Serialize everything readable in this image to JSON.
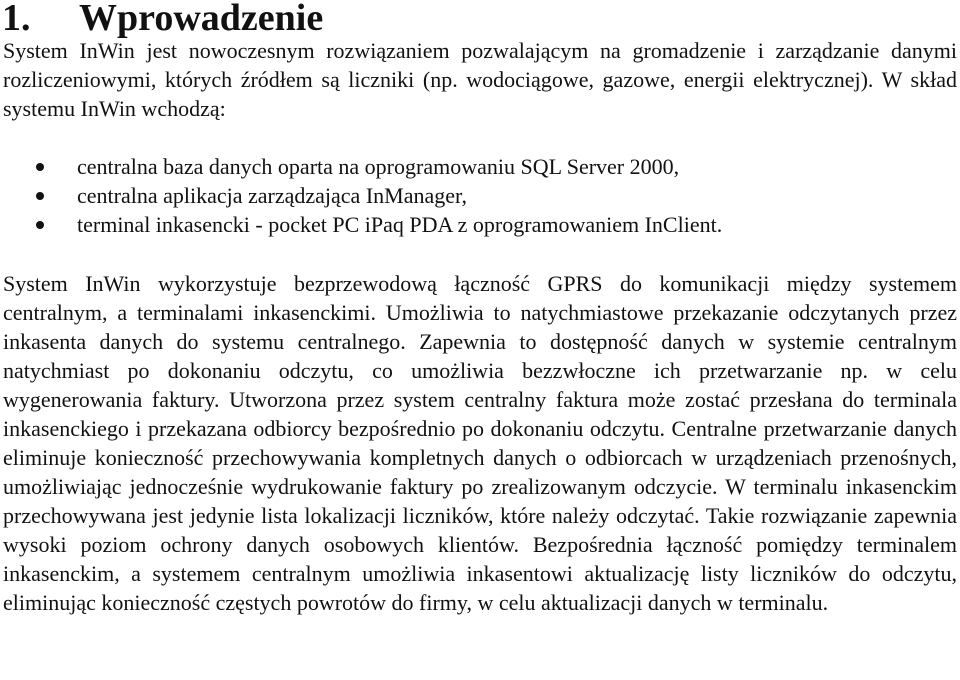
{
  "section": {
    "number": "1.",
    "title": "Wprowadzenie"
  },
  "intro_paragraph": "System InWin jest nowoczesnym rozwiązaniem pozwalającym na gromadzenie i zarządzanie danymi rozliczeniowymi, których źródłem są liczniki (np. wodociągowe, gazowe, energii elektrycznej). W skład systemu InWin wchodzą:",
  "components": [
    "centralna baza danych oparta na oprogramowaniu SQL Server 2000,",
    "centralna aplikacja zarządzająca InManager,",
    "terminal inkasencki - pocket PC iPaq PDA z oprogramowaniem InClient."
  ],
  "description_paragraph": "System InWin wykorzystuje bezprzewodową łączność GPRS do komunikacji między systemem centralnym, a terminalami inkasenckimi. Umożliwia to natychmiastowe przekazanie odczytanych przez inkasenta danych do systemu centralnego. Zapewnia to dostępność danych w systemie centralnym natychmiast po dokonaniu odczytu, co umożliwia bezzwłoczne ich przetwarzanie np. w celu wygenerowania faktury. Utworzona przez system centralny faktura może zostać przesłana do terminala inkasenckiego i przekazana odbiorcy bezpośrednio po dokonaniu odczytu. Centralne przetwarzanie danych eliminuje konieczność przechowywania kompletnych danych o odbiorcach w urządzeniach przenośnych, umożliwiając jednocześnie wydrukowanie faktury po zrealizowanym odczycie. W terminalu inkasenckim przechowywana jest jedynie lista lokalizacji liczników, które należy odczytać. Takie rozwiązanie zapewnia wysoki poziom ochrony danych osobowych klientów. Bezpośrednia łączność pomiędzy terminalem inkasenckim, a systemem centralnym umożliwia inkasentowi aktualizację listy liczników do odczytu, eliminując konieczność częstych powrotów do firmy, w celu aktualizacji danych w terminalu."
}
